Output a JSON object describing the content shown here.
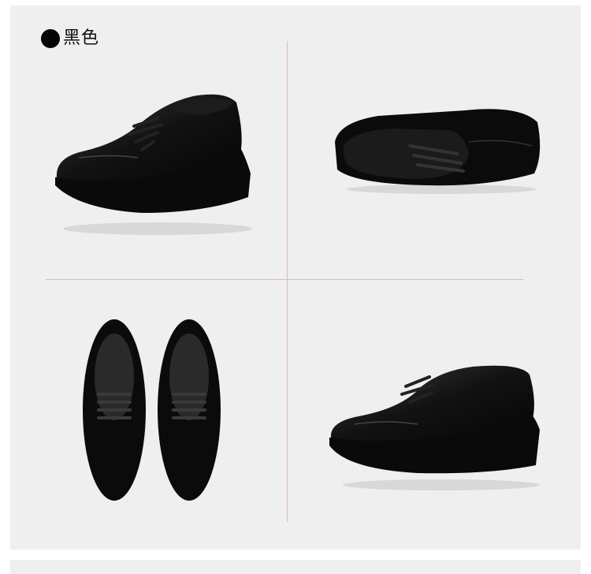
{
  "color_label": "黑色",
  "colors": {
    "background": "#efefef",
    "divider": "#d9b8bf",
    "shoe": "#0b0b0b"
  }
}
